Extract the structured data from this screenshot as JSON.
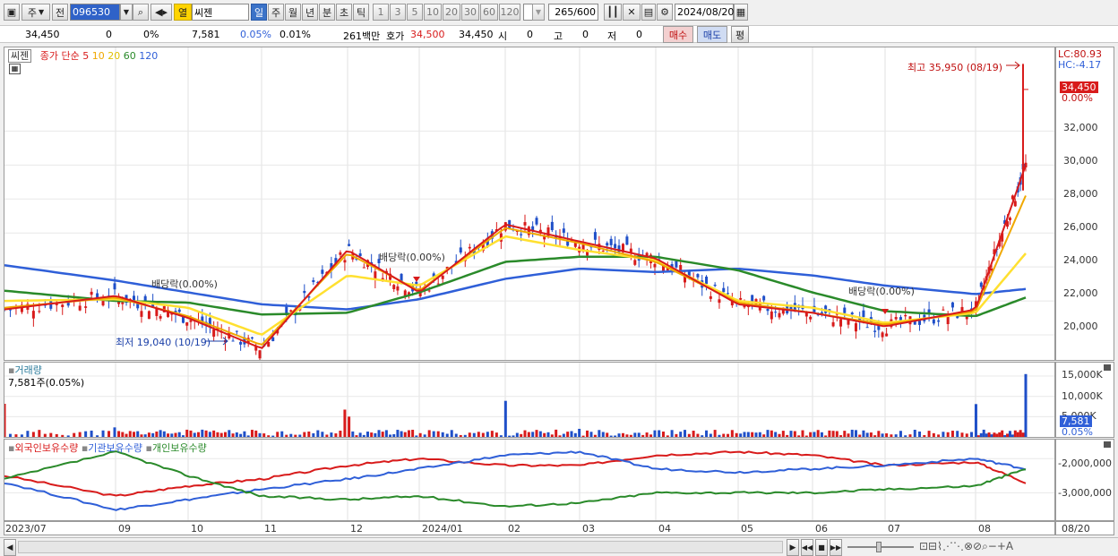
{
  "toolbar": {
    "type_label": "주",
    "prev_label": "전",
    "code": "096530",
    "yeol_label": "열",
    "name": "씨젠",
    "periods": [
      "일",
      "주",
      "월",
      "년",
      "분",
      "초",
      "틱"
    ],
    "period_selected": "일",
    "intervals": [
      "1",
      "3",
      "5",
      "10",
      "20",
      "30",
      "60",
      "120"
    ],
    "count": "265",
    "count_total": "/600",
    "date": "2024/08/20"
  },
  "infobar": {
    "price": "34,450",
    "change": "0",
    "change_pct": "0%",
    "volume": "7,581",
    "volume_pct": "0.05%",
    "turnover_pct": "0.01%",
    "amount": "261백만",
    "hoga_label": "호가",
    "hoga_value": "34,500",
    "hoga_value2": "34,450",
    "open_label": "시",
    "open_value": "0",
    "high_label": "고",
    "high_value": "0",
    "low_label": "저",
    "low_value": "0",
    "buy_label": "매수",
    "sell_label": "매도",
    "avg_label": "평"
  },
  "price_panel": {
    "stock_tab": "씨젠",
    "legend_title": "종가 단순",
    "ma_labels": [
      "5",
      "10",
      "20",
      "60",
      "120"
    ],
    "ma_colors": [
      "#d81b1b",
      "#f0a800",
      "#ffe030",
      "#2a8a2a",
      "#2f5fd8"
    ],
    "high_note": "최고 35,950 (08/19)",
    "low_note": "최저 19,040 (10/19)",
    "dividend_label": "배당락(0.00%)",
    "lc": "LC:80.93",
    "hc": "HC:-4.17",
    "last_price": "34,450",
    "last_pct": "0.00%",
    "y_ticks": [
      "32,000",
      "30,000",
      "28,000",
      "26,000",
      "24,000",
      "22,000",
      "20,000"
    ]
  },
  "volume_panel": {
    "title": "거래량",
    "current": "7,581주(0.05%)",
    "y_ticks": [
      "15,000K",
      "10,000K",
      "5,000K"
    ],
    "last_value": "7,581",
    "last_pct": "0.05%"
  },
  "holdings_panel": {
    "legends": [
      "외국인보유수량",
      "기관보유수량",
      "개인보유수량"
    ],
    "colors": [
      "#d81b1b",
      "#2f5fd8",
      "#2a8a2a"
    ],
    "y_ticks": [
      "-2,000,000",
      "-3,000,000"
    ]
  },
  "x_axis": {
    "labels": [
      "2023/07",
      "09",
      "10",
      "11",
      "12",
      "2024/01",
      "02",
      "03",
      "04",
      "05",
      "06",
      "07",
      "08",
      "08/20"
    ]
  },
  "chart_data": [
    {
      "type": "line",
      "title": "씨젠 종가 단순 5 10 20 60 120",
      "x": [
        "2023/07",
        "09",
        "10",
        "11",
        "12",
        "2024/01",
        "02",
        "03",
        "04",
        "05",
        "06",
        "07",
        "08",
        "08/20"
      ],
      "ylim": [
        19000,
        36500
      ],
      "series": [
        {
          "name": "5",
          "values": [
            21500,
            22300,
            21000,
            19200,
            25000,
            22500,
            26500,
            25500,
            24500,
            21800,
            21300,
            20500,
            21500,
            30000
          ]
        },
        {
          "name": "10",
          "values": [
            21600,
            22200,
            21100,
            19400,
            24800,
            22600,
            26300,
            25400,
            24300,
            21900,
            21300,
            20600,
            21400,
            28200
          ]
        },
        {
          "name": "20",
          "values": [
            22000,
            22100,
            21600,
            20000,
            23500,
            22900,
            25800,
            25000,
            24400,
            22000,
            21600,
            20700,
            21300,
            24800
          ]
        },
        {
          "name": "60",
          "values": [
            22600,
            22000,
            21900,
            21200,
            21300,
            22500,
            24300,
            24600,
            24600,
            23800,
            22500,
            21400,
            21100,
            22200
          ]
        },
        {
          "name": "120",
          "values": [
            24100,
            23200,
            22500,
            21800,
            21500,
            22100,
            23300,
            23900,
            23700,
            23900,
            23500,
            22900,
            22400,
            22700
          ]
        }
      ]
    },
    {
      "type": "bar",
      "title": "거래량",
      "categories": [
        "2023/07",
        "09",
        "10",
        "11",
        "12",
        "2024/01",
        "02",
        "03",
        "04",
        "05",
        "06",
        "07",
        "08",
        "08/20"
      ],
      "values": [
        9500,
        2500,
        1800,
        1200,
        7300,
        1500,
        9000,
        2200,
        1900,
        1100,
        1300,
        900,
        10000,
        15500
      ],
      "ylim": [
        0,
        17000
      ]
    },
    {
      "type": "line",
      "title": "외국인보유수량 기관보유수량 개인보유수량",
      "x": [
        "2023/07",
        "09",
        "10",
        "11",
        "12",
        "2024/01",
        "02",
        "03",
        "04",
        "05",
        "06",
        "07",
        "08",
        "08/20"
      ],
      "ylim": [
        -3700000,
        -1600000
      ],
      "series": [
        {
          "name": "외국인보유수량",
          "values": [
            -2500000,
            -3100000,
            -2800000,
            -2600000,
            -2200000,
            -2000000,
            -2200000,
            -2200000,
            -1900000,
            -1800000,
            -1900000,
            -2200000,
            -2100000,
            -2700000
          ]
        },
        {
          "name": "기관보유수량",
          "values": [
            -2700000,
            -3500000,
            -3200000,
            -2900000,
            -2600000,
            -2300000,
            -1900000,
            -1800000,
            -2300000,
            -2400000,
            -2300000,
            -2200000,
            -2000000,
            -2300000
          ]
        },
        {
          "name": "개인보유수량",
          "values": [
            -2600000,
            -1800000,
            -2500000,
            -3100000,
            -3200000,
            -3100000,
            -3400000,
            -3300000,
            -3000000,
            -3000000,
            -3000000,
            -2900000,
            -2800000,
            -2300000
          ]
        }
      ]
    }
  ]
}
